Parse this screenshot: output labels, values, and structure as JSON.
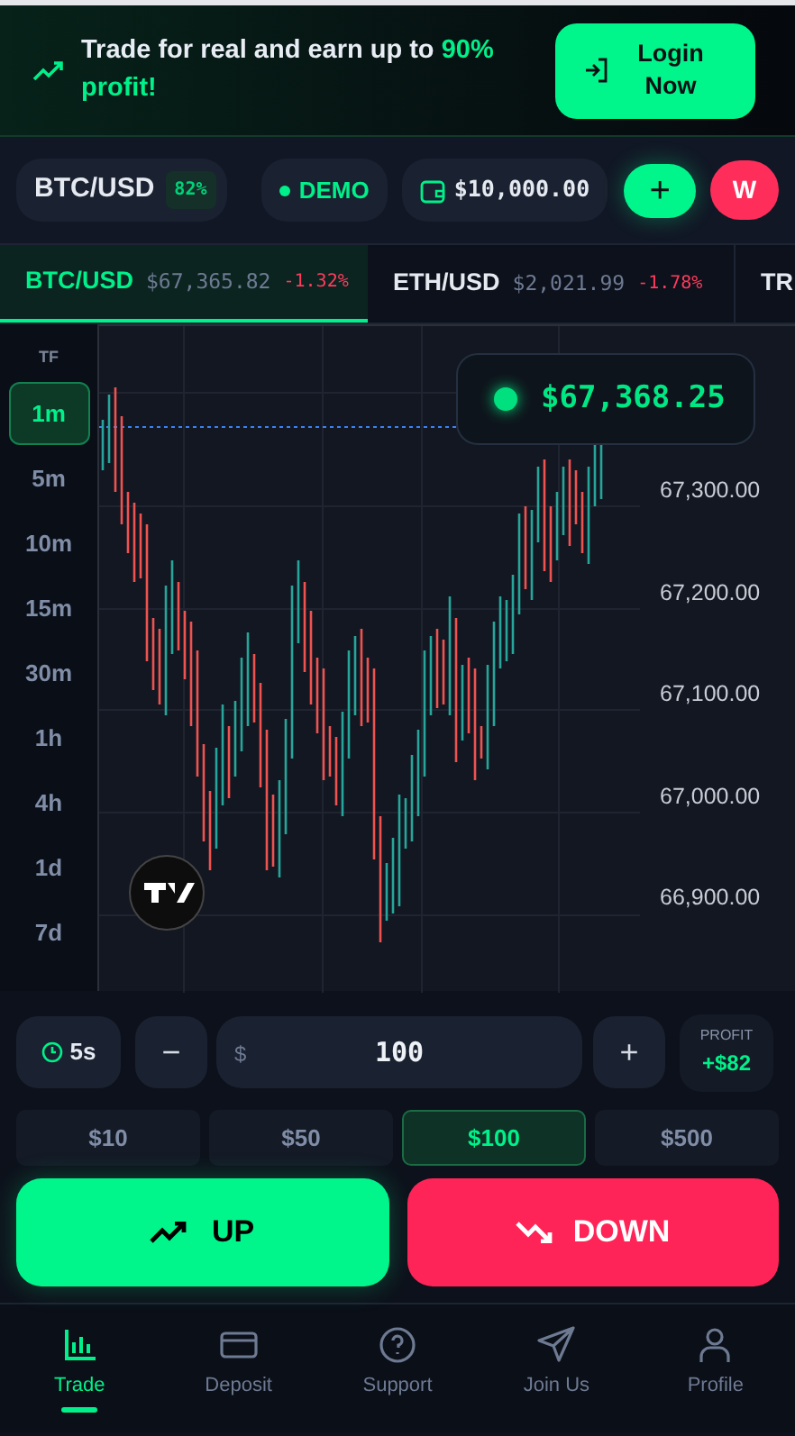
{
  "banner": {
    "message": "Trade for real and earn up to **90% profit!**",
    "login_button": "Login Now"
  },
  "header": {
    "pair": "BTC/USD",
    "payout": "82%",
    "mode": "DEMO",
    "balance": "$10,000.00",
    "add_button": "+",
    "avatar": "W"
  },
  "tickers": [
    {
      "pair": "BTC/USD",
      "price": "$67,365.82",
      "change": "-1.32%",
      "selected": true
    },
    {
      "pair": "ETH/USD",
      "price": "$2,021.99",
      "change": "-1.78%",
      "selected": false
    },
    {
      "pair": "TR",
      "selected": false
    }
  ],
  "timeframes": {
    "label": "TF",
    "items": [
      {
        "label": "1m",
        "selected": true
      },
      {
        "label": "5m",
        "selected": false
      },
      {
        "label": "10m",
        "selected": false
      },
      {
        "label": "15m",
        "selected": false
      },
      {
        "label": "30m",
        "selected": false
      },
      {
        "label": "1h",
        "selected": false
      },
      {
        "label": "4h",
        "selected": false
      },
      {
        "label": "1d",
        "selected": false
      },
      {
        "label": "7d",
        "selected": false
      }
    ]
  },
  "chart": {
    "live_price": "$67,368.25",
    "y_labels": [
      "67,300.00",
      "67,200.00",
      "67,100.00",
      "67,000.00",
      "66,900.00"
    ]
  },
  "trade": {
    "duration": "5s",
    "minus": "−",
    "currency": "$",
    "amount": "100",
    "plus": "+",
    "profit_label": "PROFIT",
    "profit": "+$82",
    "presets": [
      {
        "label": "$10",
        "selected": false
      },
      {
        "label": "$50",
        "selected": false
      },
      {
        "label": "$100",
        "selected": true
      },
      {
        "label": "$500",
        "selected": false
      }
    ],
    "up_button": "UP",
    "down_button": "DOWN"
  },
  "nav": [
    {
      "label": "Trade",
      "kind": "chart",
      "selected": true
    },
    {
      "label": "Deposit",
      "kind": "card",
      "selected": false
    },
    {
      "label": "Support",
      "kind": "help",
      "selected": false
    },
    {
      "label": "Join Us",
      "kind": "send",
      "selected": false
    },
    {
      "label": "Profile",
      "kind": "user",
      "selected": false
    }
  ]
}
